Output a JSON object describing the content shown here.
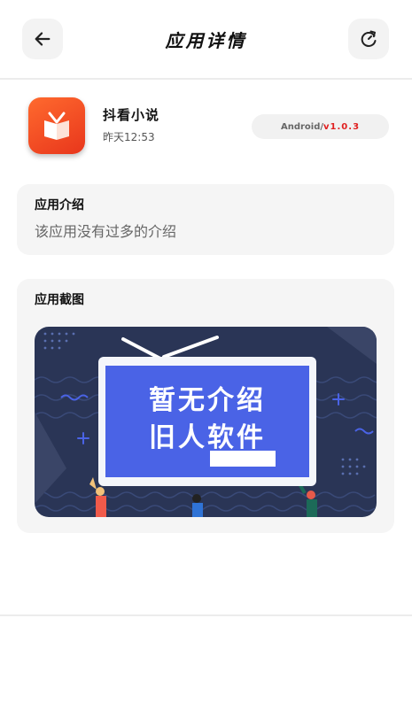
{
  "header": {
    "title": "应用详情",
    "back_icon": "arrow-left-icon",
    "refresh_icon": "refresh-icon"
  },
  "app": {
    "name": "抖看小说",
    "time": "昨天12:53",
    "platform": "Android",
    "separator": "/",
    "version": "v1.0.3",
    "icon": "book-icon",
    "icon_color": "#f24e22"
  },
  "intro": {
    "title": "应用介绍",
    "description": "该应用没有过多的介绍"
  },
  "screenshots": {
    "title": "应用截图",
    "image_line1": "暂无介绍",
    "image_line2": "旧人软件"
  }
}
